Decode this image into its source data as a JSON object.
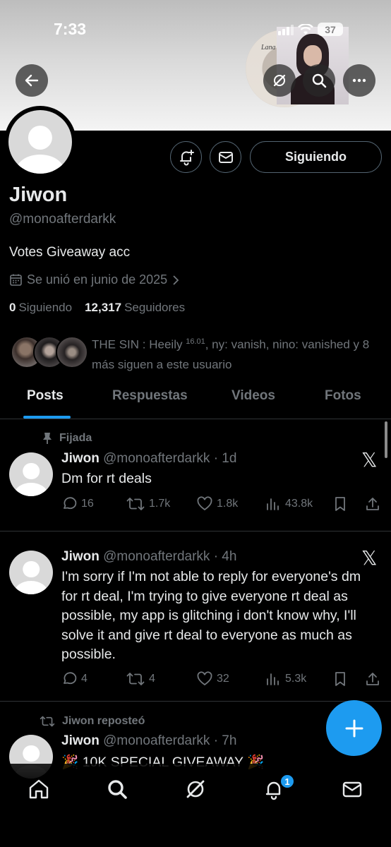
{
  "status_bar": {
    "time": "7:33",
    "battery": "37"
  },
  "header": {
    "banner_album_text": "Lana",
    "icons": [
      "back-arrow-icon",
      "grok-icon",
      "search-icon",
      "more-icon"
    ]
  },
  "profile": {
    "name": "Jiwon",
    "handle": "@monoafterdarkk",
    "bio": "Votes Giveaway acc",
    "joined": "Se unió en junio de 2025",
    "following_count": "0",
    "following_label": "Siguiendo",
    "followers_count": "12,317",
    "followers_label": "Seguidores",
    "follow_button": "Siguiendo",
    "known_followers_text_a": "THE SIN : Heeily ",
    "known_followers_sup": "16.01",
    "known_followers_text_b": ", ny: vanish, nino: vanished y 8 más siguen a este usuario"
  },
  "tabs": [
    "Posts",
    "Respuestas",
    "Videos",
    "Fotos"
  ],
  "posts": [
    {
      "context": "Fijada",
      "name": "Jiwon",
      "handle_time": "@monoafterdarkk · 1d",
      "text": "Dm for rt deals",
      "replies": "16",
      "reposts": "1.7k",
      "likes": "1.8k",
      "views": "43.8k"
    },
    {
      "context": "",
      "name": "Jiwon",
      "handle_time": "@monoafterdarkk · 4h",
      "text": "I'm sorry if I'm not able to reply for everyone's dm for rt deal, I'm trying to give everyone rt deal as possible, my app is glitching i don't know why, I'll solve it and give rt deal to everyone as much as possible.",
      "replies": "4",
      "reposts": "4",
      "likes": "32",
      "views": "5.3k"
    },
    {
      "context": "Jiwon reposteó",
      "name": "Jiwon",
      "handle_time": "@monoafterdarkk · 7h",
      "text": "🎉 10K SPECIAL GIVEAWAY 🎉"
    }
  ],
  "bottom_nav": {
    "items": [
      "home-icon",
      "search-icon",
      "grok-icon",
      "notifications-icon",
      "messages-icon"
    ],
    "notifications_badge": "1"
  },
  "colors": {
    "accent": "#1d9bf0",
    "muted": "#71767b",
    "border": "#2f3336",
    "text": "#e7e9ea"
  }
}
